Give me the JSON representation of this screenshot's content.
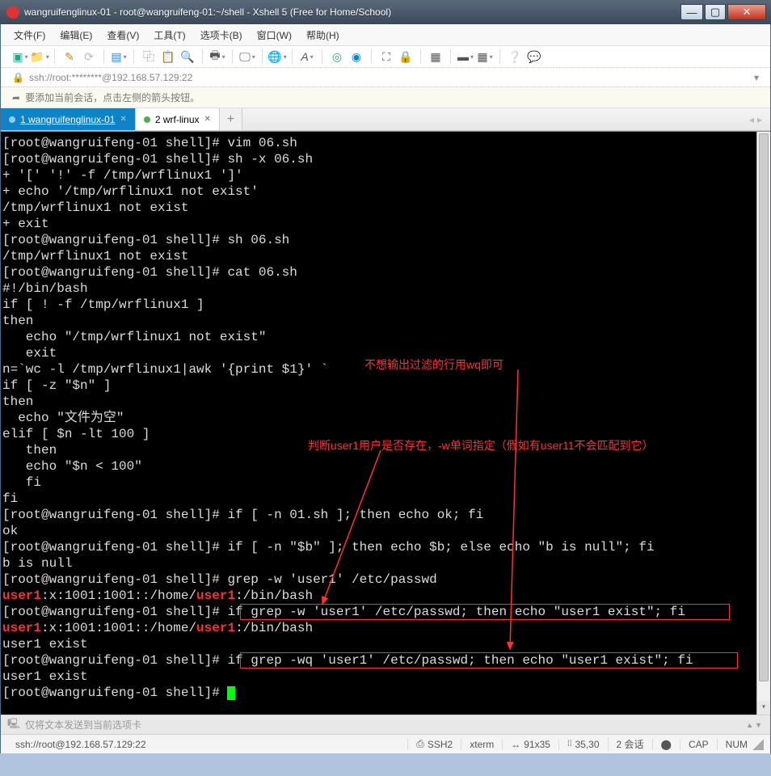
{
  "window": {
    "title": "wangruifenglinux-01 - root@wangruifeng-01:~/shell - Xshell 5 (Free for Home/School)"
  },
  "menu": {
    "file": "文件(F)",
    "edit": "编辑(E)",
    "view": "查看(V)",
    "tools": "工具(T)",
    "tabs": "选项卡(B)",
    "window": "窗口(W)",
    "help": "帮助(H)"
  },
  "address": {
    "text": "ssh://root:********@192.168.57.129:22"
  },
  "infobar": {
    "text": "要添加当前会话，点击左侧的箭头按钮。"
  },
  "tabs": {
    "active": "1 wangruifenglinux-01",
    "inactive": "2 wrf-linux"
  },
  "terminal_lines": [
    {
      "type": "prompt",
      "prompt": "[root@wangruifeng-01 shell]#",
      "cmd": " vim 06.sh"
    },
    {
      "type": "prompt",
      "prompt": "[root@wangruifeng-01 shell]#",
      "cmd": " sh -x 06.sh"
    },
    {
      "type": "plain",
      "text": "+ '[' '!' -f /tmp/wrflinux1 ']'"
    },
    {
      "type": "plain",
      "text": "+ echo '/tmp/wrflinux1 not exist'"
    },
    {
      "type": "plain",
      "text": "/tmp/wrflinux1 not exist"
    },
    {
      "type": "plain",
      "text": "+ exit"
    },
    {
      "type": "prompt",
      "prompt": "[root@wangruifeng-01 shell]#",
      "cmd": " sh 06.sh"
    },
    {
      "type": "plain",
      "text": "/tmp/wrflinux1 not exist"
    },
    {
      "type": "prompt",
      "prompt": "[root@wangruifeng-01 shell]#",
      "cmd": " cat 06.sh"
    },
    {
      "type": "plain",
      "text": "#!/bin/bash"
    },
    {
      "type": "plain",
      "text": "if [ ! -f /tmp/wrflinux1 ]"
    },
    {
      "type": "plain",
      "text": "then"
    },
    {
      "type": "plain",
      "text": "   echo \"/tmp/wrflinux1 not exist\""
    },
    {
      "type": "plain",
      "text": "   exit"
    },
    {
      "type": "plain",
      "text": "n=`wc -l /tmp/wrflinux1|awk '{print $1}' `"
    },
    {
      "type": "plain",
      "text": "if [ -z \"$n\" ]"
    },
    {
      "type": "plain",
      "text": "then"
    },
    {
      "type": "plain",
      "text": "  echo \"文件为空\""
    },
    {
      "type": "plain",
      "text": "elif [ $n -lt 100 ]"
    },
    {
      "type": "plain",
      "text": "   then"
    },
    {
      "type": "plain",
      "text": "   echo \"$n < 100\""
    },
    {
      "type": "plain",
      "text": "   fi"
    },
    {
      "type": "plain",
      "text": "fi"
    },
    {
      "type": "prompt",
      "prompt": "[root@wangruifeng-01 shell]#",
      "cmd": " if [ -n 01.sh ]; then echo ok; fi"
    },
    {
      "type": "plain",
      "text": "ok"
    },
    {
      "type": "prompt",
      "prompt": "[root@wangruifeng-01 shell]#",
      "cmd": " if [ -n \"$b\" ]; then echo $b; else echo \"b is null\"; fi"
    },
    {
      "type": "plain",
      "text": "b is null"
    },
    {
      "type": "prompt",
      "prompt": "[root@wangruifeng-01 shell]#",
      "cmd": " grep -w 'user1' /etc/passwd"
    },
    {
      "type": "grep",
      "segments": [
        {
          "t": "user1",
          "c": "red"
        },
        {
          "t": ":x:1001:1001::/home/",
          "c": ""
        },
        {
          "t": "user1",
          "c": "red"
        },
        {
          "t": ":/bin/bash",
          "c": ""
        }
      ]
    },
    {
      "type": "prompt",
      "prompt": "[root@wangruifeng-01 shell]#",
      "cmd": " if grep -w 'user1' /etc/passwd; then echo \"user1 exist\"; fi"
    },
    {
      "type": "grep",
      "segments": [
        {
          "t": "user1",
          "c": "red"
        },
        {
          "t": ":x:1001:1001::/home/",
          "c": ""
        },
        {
          "t": "user1",
          "c": "red"
        },
        {
          "t": ":/bin/bash",
          "c": ""
        }
      ]
    },
    {
      "type": "plain",
      "text": "user1 exist"
    },
    {
      "type": "prompt",
      "prompt": "[root@wangruifeng-01 shell]#",
      "cmd": " if grep -wq 'user1' /etc/passwd; then echo \"user1 exist\"; fi"
    },
    {
      "type": "plain",
      "text": "user1 exist"
    },
    {
      "type": "cursor",
      "prompt": "[root@wangruifeng-01 shell]#",
      "cmd": " "
    }
  ],
  "annotations": {
    "a1": "不想输出过滤的行用wq即可",
    "a2": "判断user1用户是否存在，-w单词指定（假如有user11不会匹配到它）"
  },
  "sendbar": {
    "text": "仅将文本发送到当前选项卡"
  },
  "status": {
    "conn": "ssh://root@192.168.57.129:22",
    "proto": "SSH2",
    "term": "xterm",
    "size": "91x35",
    "pos": "35,30",
    "sess": "2 会话",
    "cap": "CAP",
    "num": "NUM"
  }
}
